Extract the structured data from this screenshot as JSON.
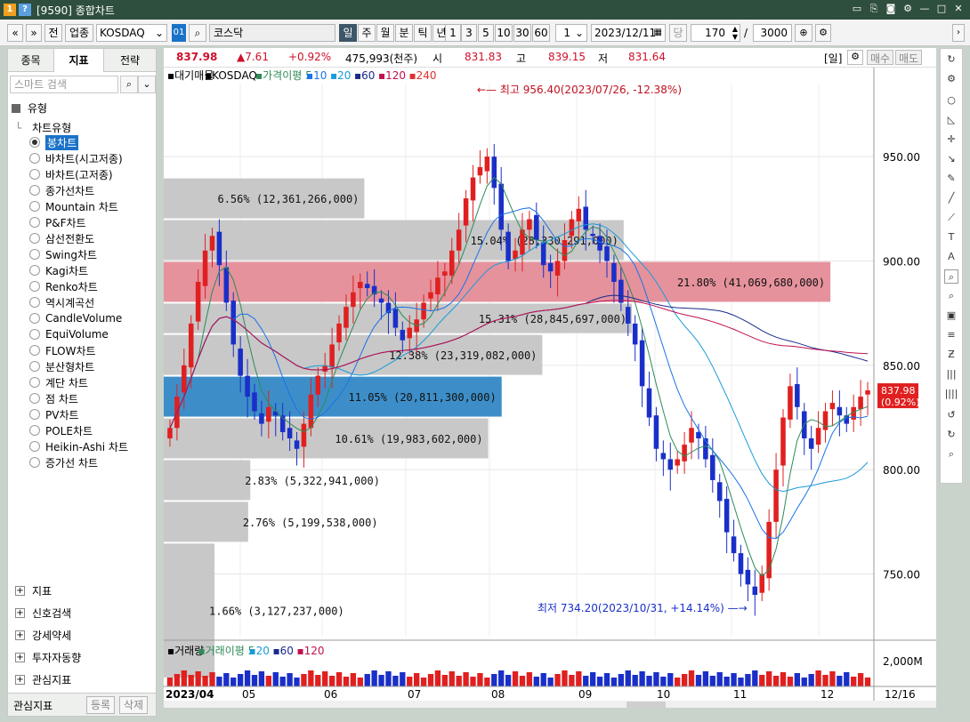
{
  "window": {
    "number": "1",
    "title": "[9590] 종합차트",
    "buttons": [
      "▭",
      "⎘",
      "◙",
      "⚙",
      "—",
      "□",
      "✕"
    ]
  },
  "toolbar": {
    "nav_prev": "«",
    "nav_down": "»",
    "btn_jeon": "전",
    "btn_upjong": "업종",
    "market": "KOSDAQ",
    "code_badge": "01",
    "search_icon": "⌕",
    "market_name": "코스닥",
    "periods": [
      "일",
      "주",
      "월",
      "분",
      "틱",
      "년"
    ],
    "intervals": [
      "1",
      "3",
      "5",
      "10",
      "30",
      "60"
    ],
    "count_field": "1",
    "date": "2023/12/11",
    "dang": "당",
    "bars": "170",
    "slash": "/",
    "total": "3000"
  },
  "left_panel": {
    "tabs": [
      "종목",
      "지표",
      "전략"
    ],
    "search_placeholder": "스마트 검색",
    "section_type": "유형",
    "chart_type_label": "차트유형",
    "chart_types": [
      "봉차트",
      "바차트(시고저종)",
      "바차트(고저종)",
      "종가선차트",
      "Mountain 차트",
      "P&F차트",
      "삼선전환도",
      "Swing차트",
      "Kagi차트",
      "Renko차트",
      "역시계곡선",
      "CandleVolume",
      "EquiVolume",
      "FLOW차트",
      "분산형차트",
      "계단 차트",
      "점 차트",
      "PV차트",
      "POLE차트",
      "Heikin-Ashi 차트",
      "증가선 차트"
    ],
    "selected_index": 0,
    "bottom_items": [
      "지표",
      "신호검색",
      "강세약세",
      "투자자동향",
      "관심지표"
    ],
    "footer_label": "관심지표",
    "footer_buttons": [
      "등록",
      "삭제"
    ]
  },
  "info_bar": {
    "price": "837.98",
    "change": "▲7.61",
    "change_pct": "+0.92%",
    "volume": "475,993(천주)",
    "open_label": "시",
    "open": "831.83",
    "high_label": "고",
    "high": "839.15",
    "low_label": "저",
    "low": "831.64",
    "period_badge": "[일]",
    "buy": "매수",
    "sell": "매도"
  },
  "chart_data": {
    "type": "candlestick",
    "legend": [
      "대기매물",
      "KOSDAQ",
      "가격이평 5",
      "10",
      "20",
      "60",
      "120",
      "240"
    ],
    "legend_colors": [
      "#000000",
      "#000000",
      "#2e8b57",
      "#1a73e8",
      "#1a9bd8",
      "#1a2a8a",
      "#c01050",
      "#e03030"
    ],
    "ylim": [
      720,
      985
    ],
    "yticks": [
      750,
      800,
      850,
      900,
      950
    ],
    "x_labels": [
      "2023/04",
      "05",
      "06",
      "07",
      "08",
      "09",
      "10",
      "11",
      "12",
      "12/16"
    ],
    "max_annotation": "최고 956.40(2023/07/26, -12.38%)",
    "min_annotation": "최저 734.20(2023/10/31, +14.14%)",
    "last_price": "837.98",
    "last_change_pct": "(0.92%)",
    "volume_profile": [
      {
        "low": 700,
        "high": 765,
        "label": "1.66% (3,127,237,000)",
        "value": 1.66
      },
      {
        "low": 765,
        "high": 785,
        "label": "2.76% (5,199,538,000)",
        "value": 2.76
      },
      {
        "low": 785,
        "high": 805,
        "label": "2.83% (5,322,941,000)",
        "value": 2.83
      },
      {
        "low": 805,
        "high": 825,
        "label": "10.61% (19,983,602,000)",
        "value": 10.61
      },
      {
        "low": 825,
        "high": 845,
        "label": "11.05% (20,811,300,000)",
        "value": 11.05,
        "highlight": "blue"
      },
      {
        "low": 845,
        "high": 865,
        "label": "12.38% (23,319,082,000)",
        "value": 12.38
      },
      {
        "low": 865,
        "high": 880,
        "label": "15.31% (28,845,697,000)",
        "value": 15.31
      },
      {
        "low": 880,
        "high": 900,
        "label": "21.80% (41,069,680,000)",
        "value": 21.8,
        "highlight": "red"
      },
      {
        "low": 900,
        "high": 920,
        "label": "15.04% (28,330,291,000)",
        "value": 15.04
      },
      {
        "low": 920,
        "high": 940,
        "label": "6.56% (12,361,266,000)",
        "value": 6.56
      }
    ],
    "close_series": [
      820,
      835,
      850,
      870,
      890,
      905,
      912,
      898,
      880,
      860,
      845,
      835,
      828,
      822,
      830,
      826,
      818,
      815,
      810,
      822,
      836,
      845,
      850,
      860,
      870,
      878,
      885,
      890,
      887,
      884,
      880,
      875,
      868,
      862,
      868,
      872,
      880,
      885,
      892,
      895,
      905,
      915,
      930,
      940,
      945,
      950,
      935,
      915,
      900,
      905,
      915,
      920,
      910,
      898,
      895,
      900,
      910,
      920,
      925,
      915,
      912,
      905,
      900,
      890,
      880,
      870,
      860,
      840,
      825,
      810,
      805,
      800,
      805,
      812,
      820,
      815,
      805,
      795,
      785,
      770,
      760,
      750,
      745,
      740,
      750,
      775,
      800,
      825,
      840,
      830,
      815,
      810,
      820,
      828,
      832,
      826,
      822,
      830,
      835,
      838
    ]
  },
  "volume_panel": {
    "legend": [
      "거래량",
      "거래이평 5",
      "20",
      "60",
      "120"
    ],
    "legend_colors": [
      "#000000",
      "#2e8b57",
      "#1a9bd8",
      "#1a2a8a",
      "#c01050"
    ],
    "ytick": "2,000M"
  }
}
